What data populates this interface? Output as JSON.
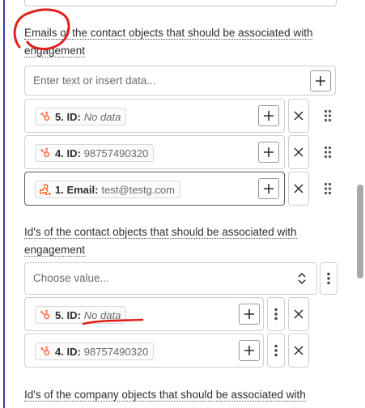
{
  "fields": [
    {
      "label": "Emails of the contact objects that should be associated with engagement",
      "input_placeholder": "Enter text or insert data...",
      "items": [
        {
          "app": "hubspot",
          "key": "5. ID:",
          "value": "No data",
          "empty": true
        },
        {
          "app": "hubspot",
          "key": "4. ID:",
          "value": "98757490320",
          "empty": false
        },
        {
          "app": "webhook",
          "key": "1. Email:",
          "value": "test@testg.com",
          "empty": false
        }
      ]
    },
    {
      "label": "Id's of the contact objects that should be associated with engagement",
      "select_placeholder": "Choose value...",
      "items": [
        {
          "app": "hubspot",
          "key": "5. ID:",
          "value": "No data",
          "empty": true
        },
        {
          "app": "hubspot",
          "key": "4. ID:",
          "value": "98757490320",
          "empty": false
        }
      ]
    },
    {
      "label": "Id's of the company objects that should be associated with"
    }
  ],
  "colors": {
    "hubspot": "#ff7a59",
    "webhook": "#ff4f00",
    "annotation": "#e0201b",
    "left_rule": "#3d3aa8"
  },
  "icons": {
    "add": "plus-icon",
    "remove": "close-icon",
    "drag": "drag-handle-icon",
    "more": "kebab-icon",
    "select": "chevron-updown-icon"
  }
}
